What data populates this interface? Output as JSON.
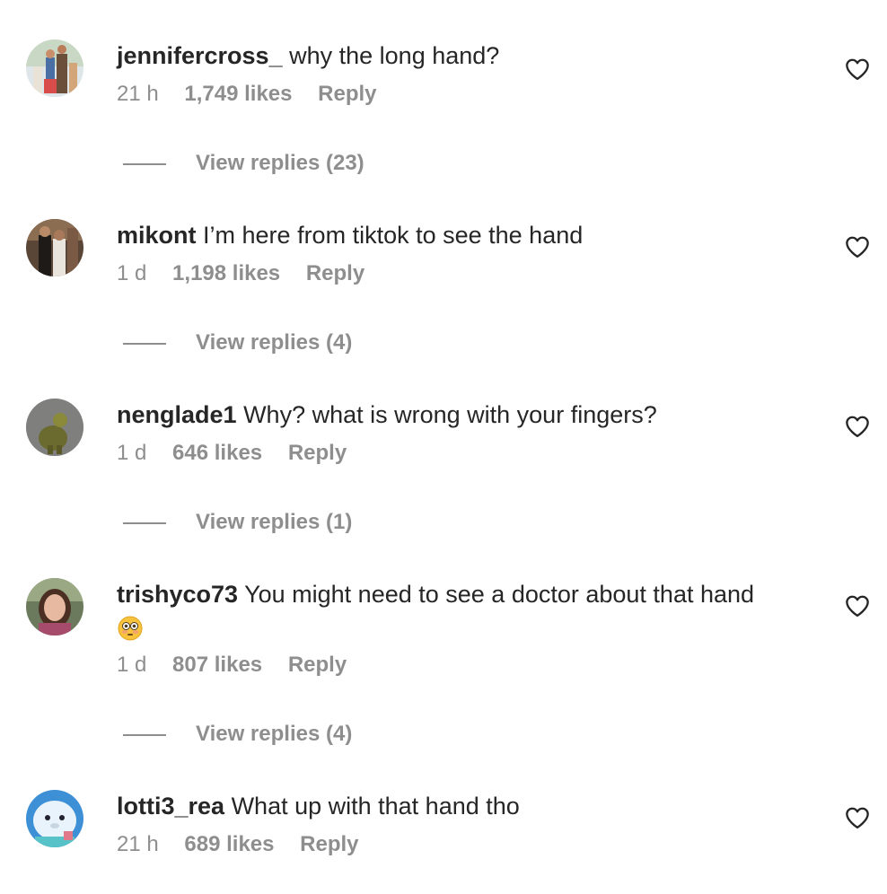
{
  "comments": [
    {
      "username": "jennifercross_",
      "text": "why the long hand?",
      "time": "21 h",
      "likes": "1,749 likes",
      "reply": "Reply",
      "view_replies": "View replies (23)"
    },
    {
      "username": "mikont",
      "text": "I’m here from tiktok to see the hand",
      "time": "1 d",
      "likes": "1,198 likes",
      "reply": "Reply",
      "view_replies": "View replies (4)"
    },
    {
      "username": "nenglade1",
      "text": "Why? what is wrong with your fingers?",
      "time": "1 d",
      "likes": "646 likes",
      "reply": "Reply",
      "view_replies": "View replies (1)"
    },
    {
      "username": "trishyco73",
      "text": "You might need to see a doctor about that hand",
      "emoji": "flushed-face-emoji",
      "time": "1 d",
      "likes": "807 likes",
      "reply": "Reply",
      "view_replies": "View replies (4)"
    },
    {
      "username": "lotti3_rea",
      "text": "What up with that hand tho",
      "time": "21 h",
      "likes": "689 likes",
      "reply": "Reply"
    }
  ],
  "icons": {
    "like": "heart-icon"
  },
  "colors": {
    "text": "#262626",
    "secondary": "#8e8e8e",
    "background": "#ffffff"
  }
}
